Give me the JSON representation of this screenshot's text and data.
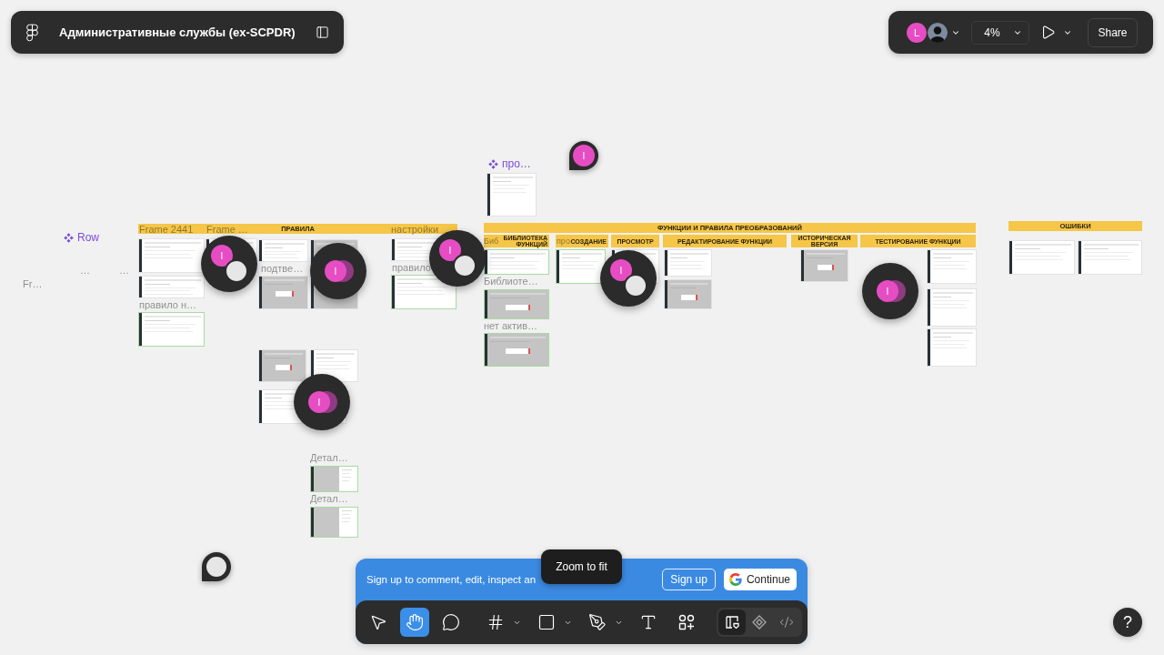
{
  "file_bar": {
    "title": "Административные службы (ex-SCPDR)"
  },
  "session_bar": {
    "collaborators": [
      {
        "kind": "initial",
        "initial": "L"
      },
      {
        "kind": "silhouette"
      }
    ],
    "zoom": "4%",
    "share": "Share"
  },
  "canvas": {
    "component_labels": [
      {
        "label": "Row"
      },
      {
        "label": "про…"
      }
    ],
    "section_headers": [
      {
        "label": "ПРАВИЛА"
      },
      {
        "label": "ФУНКЦИИ И ПРАВИЛА ПРЕОБРАЗОВАНИЙ"
      },
      {
        "label": "БИБЛИОТЕКА ФУНКЦИЙ"
      },
      {
        "label": "СОЗДАНИЕ"
      },
      {
        "label": "ПРОСМОТР"
      },
      {
        "label": "РЕДАКТИРОВАНИЕ ФУНКЦИИ"
      },
      {
        "label": "ИСТОРИЧЕСКАЯ ВЕРСИЯ"
      },
      {
        "label": "ТЕСТИРОВАНИЕ ФУНКЦИИ"
      },
      {
        "label": "ОШИБКИ"
      }
    ],
    "frame_labels": [
      {
        "label": "Frame 2441"
      },
      {
        "label": "Frame …"
      },
      {
        "label": "подтве…"
      },
      {
        "label": "правило н…"
      },
      {
        "label": "настройки"
      },
      {
        "label": "правило"
      },
      {
        "label": "Биб"
      },
      {
        "label": "про"
      },
      {
        "label": "Библиоте…"
      },
      {
        "label": "нет актив…"
      },
      {
        "label": "Детал…"
      },
      {
        "label": "Детал…"
      },
      {
        "label": "Fr…"
      },
      {
        "label": "…"
      },
      {
        "label": "…"
      }
    ],
    "comment_pins": [
      {
        "kind": "pair",
        "initial": "I"
      },
      {
        "kind": "stack",
        "initial": "I"
      },
      {
        "kind": "pair",
        "initial": "I"
      },
      {
        "kind": "pair",
        "initial": "I"
      },
      {
        "kind": "stack",
        "initial": "I"
      },
      {
        "kind": "stack",
        "initial": "I"
      },
      {
        "kind": "pin",
        "initial": "I"
      },
      {
        "kind": "blank_pin"
      }
    ]
  },
  "signup_banner": {
    "message": "Sign up to comment, edit, inspect an",
    "sign_up": "Sign up",
    "continue": "Continue"
  },
  "tooltip": {
    "text": "Zoom to fit"
  },
  "toolbar": {
    "tool_groups": [
      {
        "tools": [
          {
            "kind": "move",
            "selected": false,
            "menu": false
          },
          {
            "kind": "hand",
            "selected": true,
            "menu": false
          },
          {
            "kind": "comment",
            "selected": false,
            "menu": false
          }
        ]
      },
      {
        "tools": [
          {
            "kind": "frame",
            "selected": false,
            "menu": true
          },
          {
            "kind": "shape",
            "selected": false,
            "menu": true
          },
          {
            "kind": "pen",
            "selected": false,
            "menu": true
          },
          {
            "kind": "text",
            "selected": false,
            "menu": false
          },
          {
            "kind": "actions",
            "selected": false,
            "menu": false
          }
        ]
      }
    ],
    "modes": [
      {
        "kind": "design",
        "selected": true
      },
      {
        "kind": "prototype",
        "selected": false
      },
      {
        "kind": "code",
        "selected": false
      }
    ]
  },
  "help_button": {
    "label": "?"
  }
}
